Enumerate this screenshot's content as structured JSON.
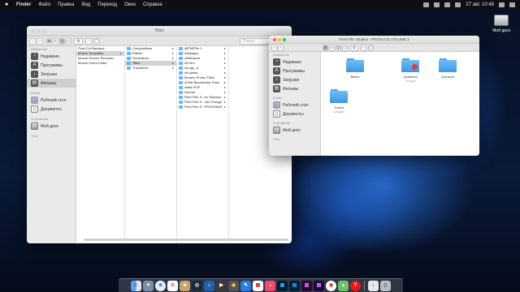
{
  "menubar": {
    "app": "Finder",
    "items": [
      "Файл",
      "Правка",
      "Вид",
      "Переход",
      "Окно",
      "Справка"
    ],
    "clock": "27 авг. 10:48"
  },
  "desktop": {
    "drive_label": "Мой диск"
  },
  "win1": {
    "title": "Titles",
    "search_placeholder": "Поиск",
    "sidebar": {
      "favorites_header": "Избранное",
      "favorites": [
        "Недавние",
        "Программы",
        "Загрузки",
        "Фильмы"
      ],
      "icloud_header": "iCloud",
      "icloud": [
        "Рабочий стол",
        "Документы"
      ],
      "devices_header": "Устройства",
      "devices": [
        "Мой диск"
      ],
      "tags_header": "Теги"
    },
    "col1": [
      "Final Cut Backups",
      "Motion Templates",
      "Movavi Screen Recorder",
      "Movavi Video Editor"
    ],
    "col2": [
      "Compositions",
      "Effects",
      "Generators",
      "Titles",
      "Transitions"
    ],
    "col3": [
      "@PMRTsr 1",
      "mBadges",
      "mBehavior",
      "mForm",
      "mLogo_A",
      "mLowers",
      "Modern Promo Titles",
      "mTitle Blockbuster Pack",
      "mtitle POP",
      "Normal",
      "Pixel Film S...tro Glamour",
      "Pixel Film S...ntro Grunge",
      "Pixel Film S...PROSHAKE"
    ]
  },
  "win2": {
    "title": "Pixel Film Studios - PROSLICE VOLUME 2",
    "sidebar": {
      "favorites_header": "Избранное",
      "favorites": [
        "Недавние",
        "Программы",
        "Загрузки",
        "Фильмы"
      ],
      "icloud_header": "iCloud",
      "icloud": [
        "Рабочий стол",
        "Документы"
      ],
      "devices_header": "Устройства",
      "devices": [
        "Мой диск"
      ],
      "tags_header": "Теги"
    },
    "folders": [
      {
        "name": "Bisect",
        "sub": ""
      },
      {
        "name": "Quadsect",
        "sub": "Сегодня"
      },
      {
        "name": "Quinsect",
        "sub": ""
      },
      {
        "name": "Trisect",
        "sub": "Сегодня"
      }
    ]
  },
  "dock": {
    "icons": [
      "finder-icon",
      "launchpad-icon",
      "safari-icon",
      "photos-icon",
      "contacts-icon",
      "steam-icon",
      "sourcetree-icon",
      "finalcut-icon",
      "motion-icon",
      "paint-icon",
      "calendar-icon",
      "music-icon",
      "lightroom-icon",
      "photoshop-icon",
      "premiere-icon",
      "aftereffects-icon",
      "chrome-icon",
      "maps-icon",
      "yandex-icon",
      "downloads-icon",
      "trash-icon"
    ]
  }
}
